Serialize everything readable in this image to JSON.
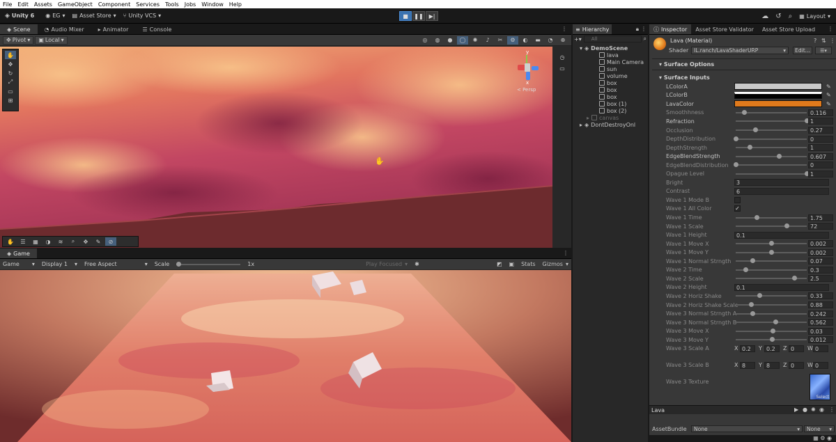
{
  "menu": [
    "File",
    "Edit",
    "Assets",
    "GameObject",
    "Component",
    "Services",
    "Tools",
    "Jobs",
    "Window",
    "Help"
  ],
  "toolbar": {
    "unity": "Unity 6",
    "account": "EG",
    "asset_store": "Asset Store",
    "vcs": "Unity VCS",
    "layout": "Layout"
  },
  "scene_tabs": [
    "Scene",
    "Audio Mixer",
    "Animator",
    "Console"
  ],
  "scene_toolbar": {
    "pivot": "Pivot",
    "local": "Local"
  },
  "gizmo": {
    "y": "y",
    "x": "x",
    "persp": "< Persp"
  },
  "game": {
    "tab": "Game",
    "mode": "Game",
    "display": "Display 1",
    "aspect": "Free Aspect",
    "scale_label": "Scale",
    "scale_value": "1x",
    "play_focused": "Play Focused",
    "stats": "Stats",
    "gizmos": "Gizmos"
  },
  "hierarchy": {
    "title": "Hierarchy",
    "search": "All",
    "scene": "DemoScene",
    "items": [
      "lava",
      "Main Camera",
      "sun",
      "volume",
      "box",
      "box",
      "box",
      "box (1)",
      "box (2)"
    ],
    "disabled_item": "canvas",
    "ddol": "DontDestroyOnl"
  },
  "inspector": {
    "tabs": [
      "Inspector",
      "Asset Store Validator",
      "Asset Store Upload"
    ],
    "material": "Lava (Material)",
    "shader_label": "Shader",
    "shader": "IL.ranch/LavaShaderURP",
    "edit": "Edit...",
    "surface_options": "Surface Options",
    "surface_inputs": "Surface Inputs",
    "colors": [
      {
        "label": "LColorA",
        "color": "#c8c8c8"
      },
      {
        "label": "LColorB",
        "color": "#000000"
      },
      {
        "label": "LavaColor",
        "color": "#e07a1c"
      }
    ],
    "sliders": [
      {
        "label": "Smoothhness",
        "value": "0.116",
        "frac": 0.116,
        "dim": true
      },
      {
        "label": "Refraction",
        "value": "1",
        "frac": 1.0,
        "dim": false
      },
      {
        "label": "Occlusion",
        "value": "0.27",
        "frac": 0.27,
        "dim": true
      },
      {
        "label": "DepthDistribution",
        "value": "0",
        "frac": 0.0,
        "dim": true
      },
      {
        "label": "DepthStrength",
        "value": "1",
        "frac": 0.2,
        "dim": true
      },
      {
        "label": "EdgeBlendStrength",
        "value": "0.607",
        "frac": 0.607,
        "dim": false
      },
      {
        "label": "EdgeBlendDistribution",
        "value": "0",
        "frac": 0.0,
        "dim": true
      },
      {
        "label": "Opague Level",
        "value": "1",
        "frac": 1.0,
        "dim": true
      }
    ],
    "bright": {
      "label": "Bright",
      "value": "3"
    },
    "contrast": {
      "label": "Contrast",
      "value": "6"
    },
    "wave1_mode_b": {
      "label": "Wave 1 Mode B",
      "checked": ""
    },
    "wave1_all_color": {
      "label": "Wave 1 All Color",
      "checked": "✓"
    },
    "waves": [
      {
        "label": "Wave 1 Time",
        "value": "1.75",
        "frac": 0.29
      },
      {
        "label": "Wave 1 Scale",
        "value": "72",
        "frac": 0.72
      }
    ],
    "wave1_height": {
      "label": "Wave 1 Height",
      "value": "0.1"
    },
    "waves2": [
      {
        "label": "Wave 1 Move X",
        "value": "0.002",
        "frac": 0.5
      },
      {
        "label": "Wave 1 Move Y",
        "value": "0.002",
        "frac": 0.5
      },
      {
        "label": "Wave 1 Normal Strngth",
        "value": "0.07",
        "frac": 0.24
      },
      {
        "label": "Wave 2 Time",
        "value": "0.3",
        "frac": 0.14
      },
      {
        "label": "Wave 2 Scale",
        "value": "2.5",
        "frac": 0.82
      }
    ],
    "wave2_height": {
      "label": "Wave 2 Height",
      "value": "0.1"
    },
    "waves3": [
      {
        "label": "Wave 2 Horiz Shake",
        "value": "0.33",
        "frac": 0.33
      },
      {
        "label": "Wave 2 Horiz Shake Scale",
        "value": "0.88",
        "frac": 0.22
      },
      {
        "label": "Wave 3 Normal Strngth A",
        "value": "0.242",
        "frac": 0.24
      },
      {
        "label": "Wave 3 Normal Strngth B",
        "value": "0.562",
        "frac": 0.56
      },
      {
        "label": "Wave 3 Move X",
        "value": "0.03",
        "frac": 0.52
      },
      {
        "label": "Wave 3 Move Y",
        "value": "0.012",
        "frac": 0.51
      }
    ],
    "wave3_scale_a": {
      "label": "Wave 3 Scale A",
      "x": "0.2",
      "y": "0.2",
      "z": "0",
      "w": "0"
    },
    "wave3_scale_b": {
      "label": "Wave 3 Scale B",
      "x": "8",
      "y": "8",
      "z": "0",
      "w": "0"
    },
    "wave3_texture": {
      "label": "Wave 3 Texture",
      "select": "Select"
    },
    "vec_axes": {
      "x": "X",
      "y": "Y",
      "z": "Z",
      "w": "W"
    },
    "preview_name": "Lava",
    "assetbundle_label": "AssetBundle",
    "assetbundle": "None",
    "assetbundle_variant": "None"
  }
}
